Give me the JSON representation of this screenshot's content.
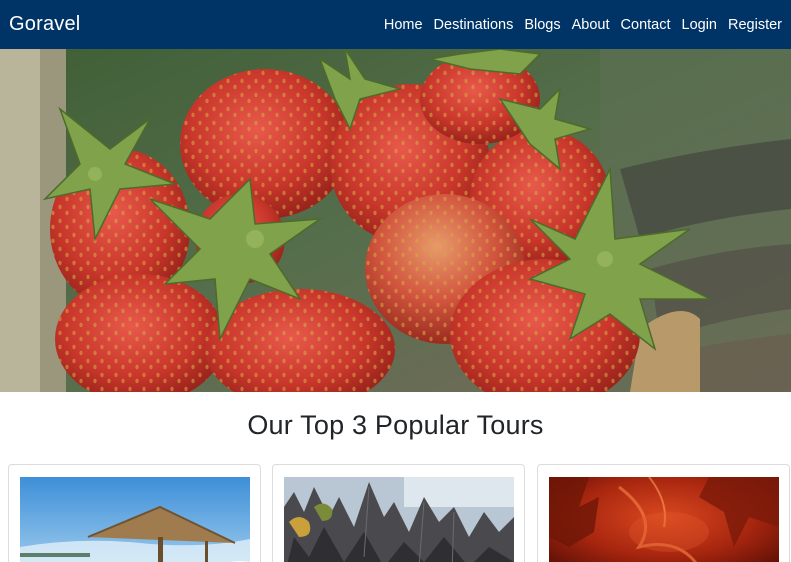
{
  "brand": {
    "name": "Goravel"
  },
  "nav": {
    "items": [
      {
        "label": "Home"
      },
      {
        "label": "Destinations"
      },
      {
        "label": "Blogs"
      },
      {
        "label": "About"
      },
      {
        "label": "Contact"
      },
      {
        "label": "Login"
      },
      {
        "label": "Register"
      }
    ]
  },
  "hero": {
    "image": "strawberries-basket-photo"
  },
  "popular": {
    "title": "Our Top 3 Popular Tours",
    "tours": [
      {
        "image": "beach-hut-photo"
      },
      {
        "image": "limestone-rock-forest-photo"
      },
      {
        "image": "red-cave-photo"
      }
    ]
  },
  "colors": {
    "navbar": "#003366",
    "text": "#212529",
    "card_border": "#dcdcdc"
  }
}
